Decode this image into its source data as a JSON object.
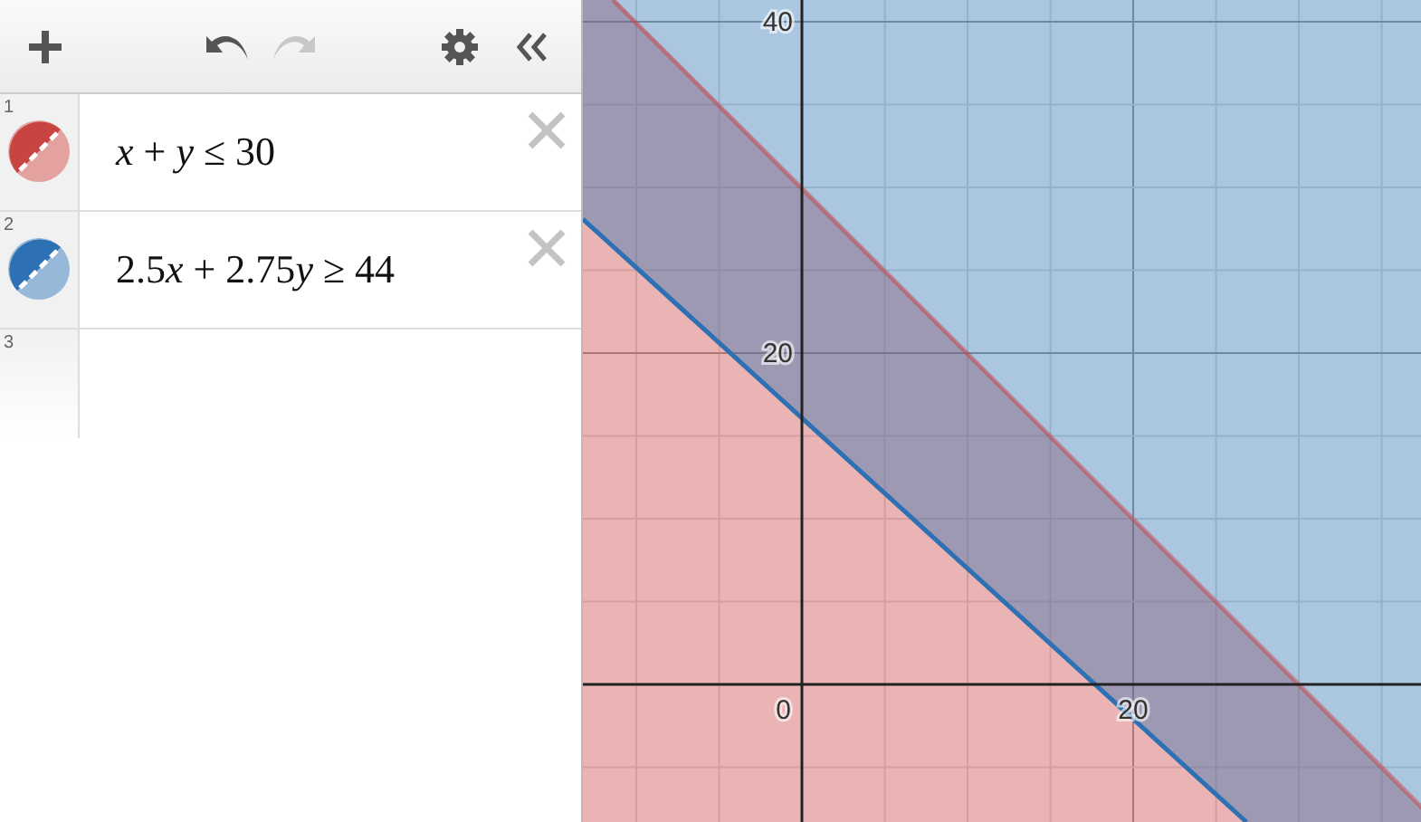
{
  "toolbar": [
    {
      "kind": "add",
      "disabled": false
    },
    {
      "kind": "undo",
      "disabled": false
    },
    {
      "kind": "redo",
      "disabled": true
    },
    {
      "kind": "settings",
      "disabled": false
    },
    {
      "kind": "collapse",
      "disabled": false
    }
  ],
  "expressions": [
    {
      "number": "1",
      "terms": [
        {
          "text": "x",
          "kind": "variable"
        },
        {
          "text": " + ",
          "kind": "plain"
        },
        {
          "text": "y",
          "kind": "variable"
        },
        {
          "text": " ≤ 30",
          "kind": "plain"
        }
      ],
      "color": "#c74440"
    },
    {
      "number": "2",
      "terms": [
        {
          "text": "2.5",
          "kind": "plain"
        },
        {
          "text": "x",
          "kind": "variable"
        },
        {
          "text": " + 2.75",
          "kind": "plain"
        },
        {
          "text": "y",
          "kind": "variable"
        },
        {
          "text": " ≥ 44",
          "kind": "plain"
        }
      ],
      "color": "#2d70b3"
    },
    {
      "number": "3"
    }
  ],
  "graph": {
    "y_labels": [
      "40",
      "20"
    ],
    "origin_label": "0",
    "x_labels": [
      "20"
    ]
  }
}
